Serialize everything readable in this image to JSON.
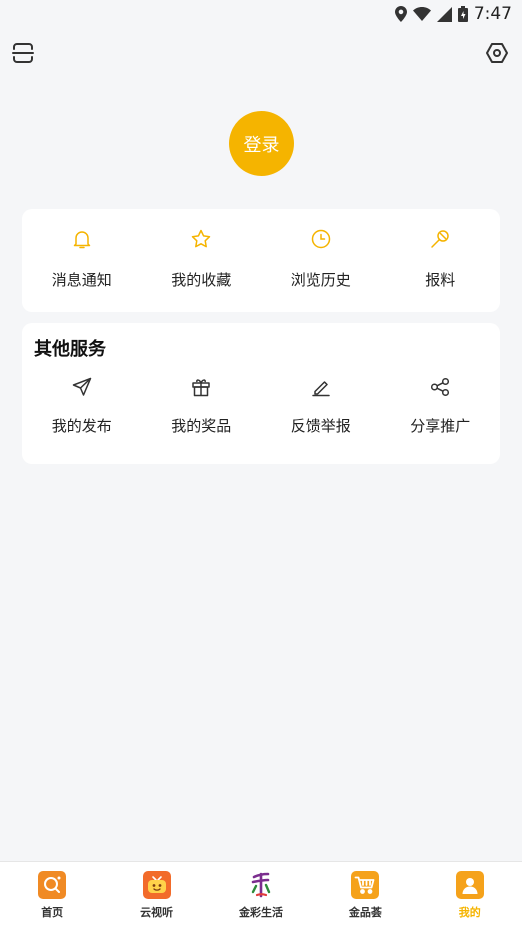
{
  "status_bar": {
    "time": "7:47"
  },
  "header": {
    "login_label": "登录"
  },
  "quick_actions": [
    {
      "label": "消息通知",
      "icon": "bell-icon"
    },
    {
      "label": "我的收藏",
      "icon": "star-icon"
    },
    {
      "label": "浏览历史",
      "icon": "clock-icon"
    },
    {
      "label": "报料",
      "icon": "microphone-icon"
    }
  ],
  "other_services": {
    "title": "其他服务",
    "items": [
      {
        "label": "我的发布",
        "icon": "send-icon"
      },
      {
        "label": "我的奖品",
        "icon": "gift-icon"
      },
      {
        "label": "反馈举报",
        "icon": "edit-icon"
      },
      {
        "label": "分享推广",
        "icon": "share-icon"
      }
    ]
  },
  "tabbar": {
    "tabs": [
      {
        "label": "首页",
        "icon": "home-search-icon"
      },
      {
        "label": "云视听",
        "icon": "tv-icon"
      },
      {
        "label": "金彩生活",
        "icon": "jincai-logo-icon"
      },
      {
        "label": "金品荟",
        "icon": "cart-icon"
      },
      {
        "label": "我的",
        "icon": "profile-icon",
        "active": true
      }
    ]
  },
  "colors": {
    "accent": "#f5b400",
    "background": "#f5f6f8",
    "card": "#ffffff"
  }
}
